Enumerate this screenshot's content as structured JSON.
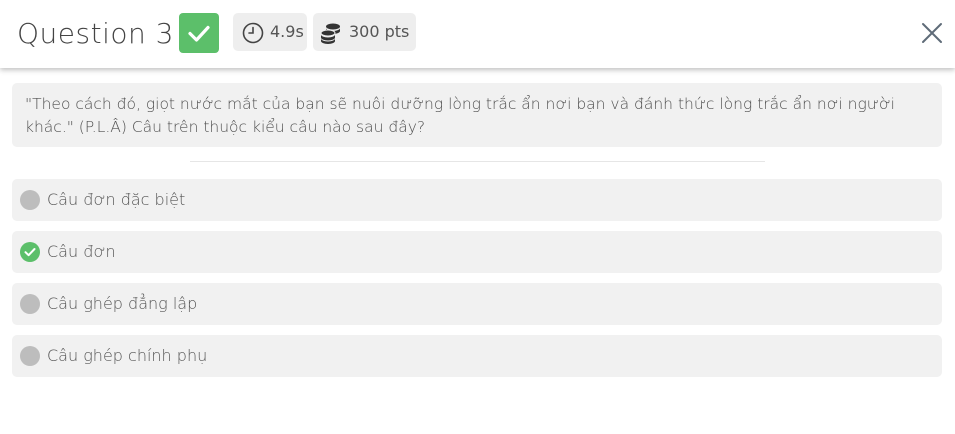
{
  "header": {
    "title": "Question 3",
    "status_icon": "check-icon",
    "status_color": "#5cbf6a",
    "time": "4.9s",
    "time_icon": "clock-icon",
    "points": "300 pts",
    "points_icon": "coins-icon",
    "close_icon": "close-icon"
  },
  "question": {
    "text": "\"Theo cách đó, giọt nước mắt của bạn sẽ nuôi dưỡng lòng trắc ẩn nơi bạn và đánh thức lòng trắc ẩn nơi người khác.\" (P.L.Â) Câu trên thuộc kiểu câu nào sau đây?"
  },
  "answers": [
    {
      "label": "Câu đơn đặc biệt",
      "correct": false
    },
    {
      "label": "Câu đơn",
      "correct": true
    },
    {
      "label": "Câu ghép đẳng lập",
      "correct": false
    },
    {
      "label": "Câu ghép chính phụ",
      "correct": false
    }
  ],
  "colors": {
    "correct": "#5cbf6a",
    "neutral_radio": "#bdbdbd",
    "answer_bg": "#f1f1f1"
  }
}
